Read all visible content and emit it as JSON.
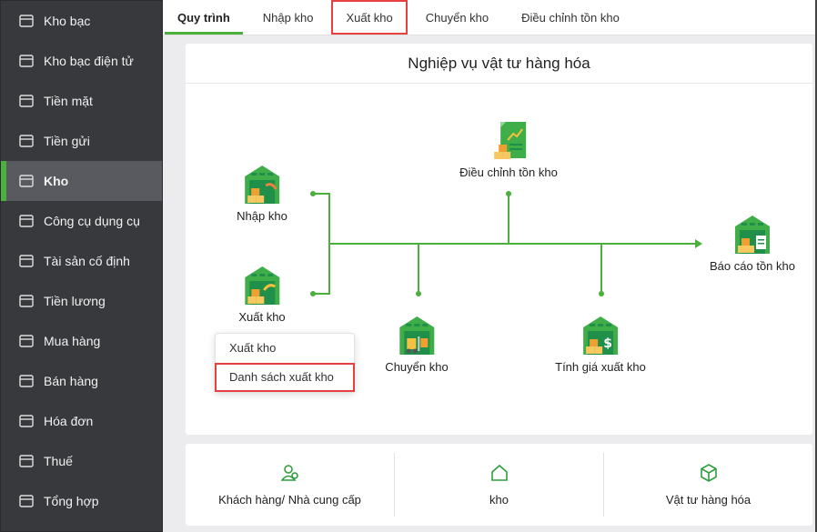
{
  "sidebar": {
    "items": [
      {
        "label": "Kho bạc",
        "icon": "bank-icon"
      },
      {
        "label": "Kho bạc điện tử",
        "icon": "monitor-dollar-icon"
      },
      {
        "label": "Tiền mặt",
        "icon": "cash-icon"
      },
      {
        "label": "Tiền gửi",
        "icon": "deposit-icon"
      },
      {
        "label": "Kho",
        "icon": "box-icon",
        "active": true
      },
      {
        "label": "Công cụ dụng cụ",
        "icon": "tools-icon"
      },
      {
        "label": "Tài sản cố định",
        "icon": "car-house-icon"
      },
      {
        "label": "Tiền lương",
        "icon": "payroll-icon"
      },
      {
        "label": "Mua hàng",
        "icon": "shopping-bag-icon"
      },
      {
        "label": "Bán hàng",
        "icon": "cart-icon"
      },
      {
        "label": "Hóa đơn",
        "icon": "invoice-icon"
      },
      {
        "label": "Thuế",
        "icon": "tax-icon"
      },
      {
        "label": "Tổng hợp",
        "icon": "report-icon"
      }
    ]
  },
  "tabs": [
    "Quy trình",
    "Nhập kho",
    "Xuất kho",
    "Chuyển kho",
    "Điều chỉnh tồn kho"
  ],
  "card": {
    "title": "Nghiệp vụ vật tư hàng hóa"
  },
  "nodes": {
    "nhap": "Nhập kho",
    "xuat": "Xuất kho",
    "dieu_chinh": "Điều chỉnh tồn kho",
    "chuyen": "Chuyển kho",
    "tinh_gia": "Tính giá xuất kho",
    "bao_cao": "Báo cáo tồn kho"
  },
  "popup": [
    "Xuất kho",
    "Danh sách xuất kho"
  ],
  "bottom": [
    "Khách hàng/ Nhà cung cấp",
    "kho",
    "Vật tư hàng hóa"
  ],
  "colors": {
    "accent": "#4caf3e",
    "highlight": "#e84040",
    "sidebar": "#38393d"
  }
}
